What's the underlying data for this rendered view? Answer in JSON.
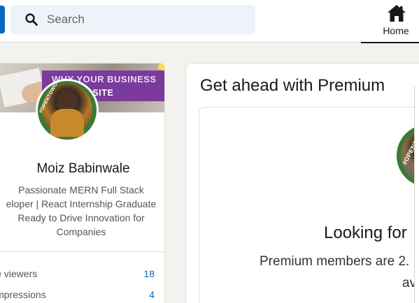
{
  "search": {
    "placeholder": "Search"
  },
  "nav": {
    "home_label": "Home"
  },
  "profile": {
    "banner_line1": "WHY YOUR BUSINESS",
    "banner_line2": "A WEBSITE",
    "avatar_tag": "#OPENTOWORK",
    "name": "Moiz Babinwale",
    "headline_lines": [
      "Passionate MERN Full Stack",
      "eloper | React Internship Graduate",
      "Ready to Drive Innovation for",
      "Companies"
    ],
    "stats": [
      {
        "label": "le viewers",
        "value": "18"
      },
      {
        "label": "impressions",
        "value": "4"
      }
    ]
  },
  "premium": {
    "title": "Get ahead with Premium",
    "avatar_tag": "#OPENTO",
    "looking": "Looking for",
    "members_line1": "Premium members are 2.",
    "members_line2": "av"
  },
  "colors": {
    "accent": "#0a66c2",
    "opentowork_green": "#3b7a34",
    "banner_purple": "#7a3b9c"
  }
}
